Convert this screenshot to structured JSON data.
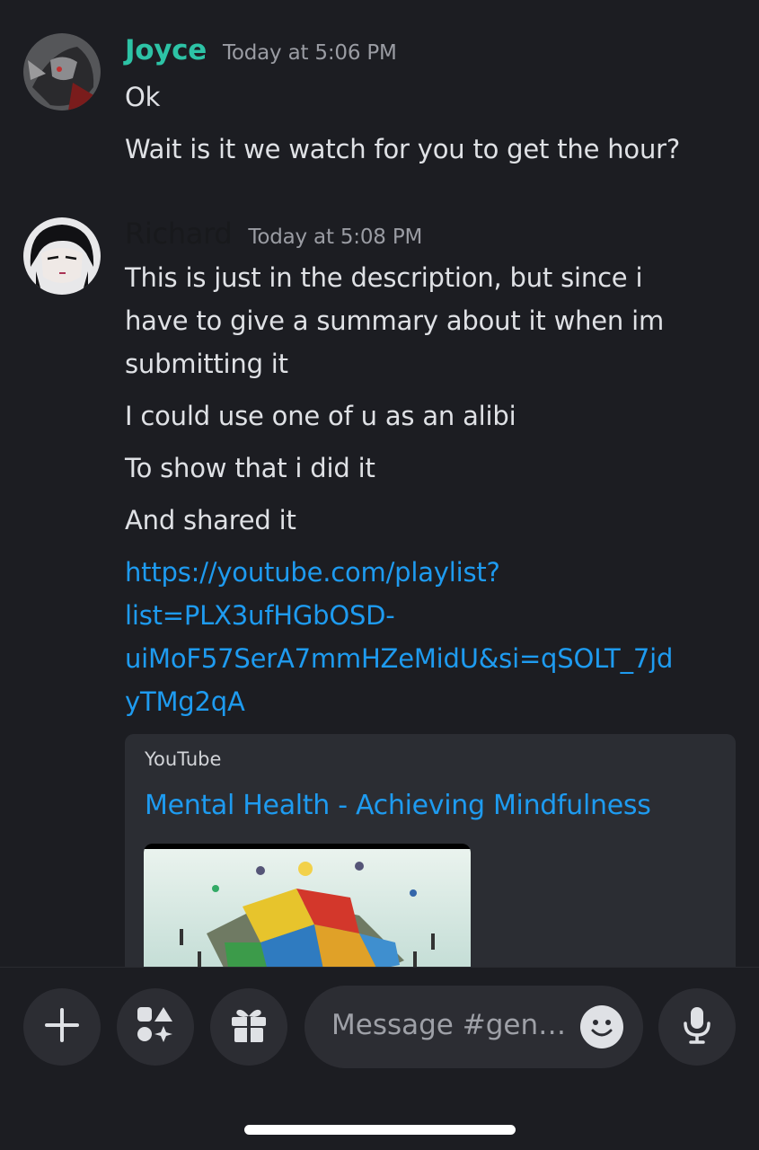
{
  "messages": [
    {
      "author": "Joyce",
      "author_color": "#2dc3a6",
      "timestamp": "Today at 5:06 PM",
      "lines": [
        "Ok",
        "Wait is it  we watch for you to get the hour?"
      ]
    },
    {
      "author": "Richard",
      "author_color": "#18191c",
      "timestamp": "Today at 5:08 PM",
      "lines": [
        "This is just in the description, but since i",
        "have to give a summary about it when im",
        "submitting it",
        "I could use one of u as an alibi",
        "To show that i did it",
        "And shared it"
      ],
      "link_lines": [
        "https://youtube.com/playlist?",
        "list=PLX3ufHGbOSD-",
        "uiMoF57SerA7mmHZeMidU&si=qSOLT_7jd",
        "yTMg2qA"
      ],
      "embed": {
        "provider": "YouTube",
        "title": "Mental Health - Achieving Mindfulness"
      }
    }
  ],
  "composer": {
    "placeholder": "Message #gene...",
    "buttons": [
      "plus-icon",
      "apps-icon",
      "gift-icon",
      "microphone-icon"
    ]
  },
  "colors": {
    "link": "#1e9bf0",
    "background": "#1c1d22",
    "surface": "#2c2d33"
  }
}
